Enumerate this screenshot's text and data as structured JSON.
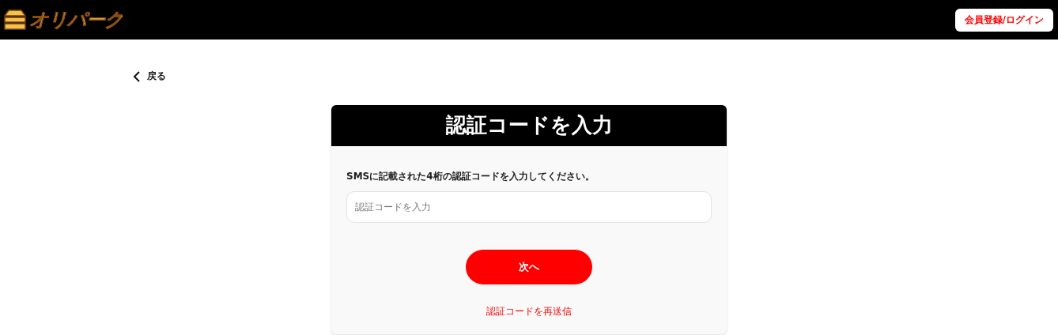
{
  "header": {
    "logo_text": "オリパーク",
    "register_button": "会員登録/ログイン"
  },
  "back_link": "戻る",
  "card": {
    "title": "認証コードを入力",
    "instruction": "SMSに記載された4桁の認証コードを入力してください。",
    "code_field": {
      "placeholder": "認証コードを入力"
    },
    "next_button": "次へ",
    "resend_link": "認証コードを再送信"
  }
}
